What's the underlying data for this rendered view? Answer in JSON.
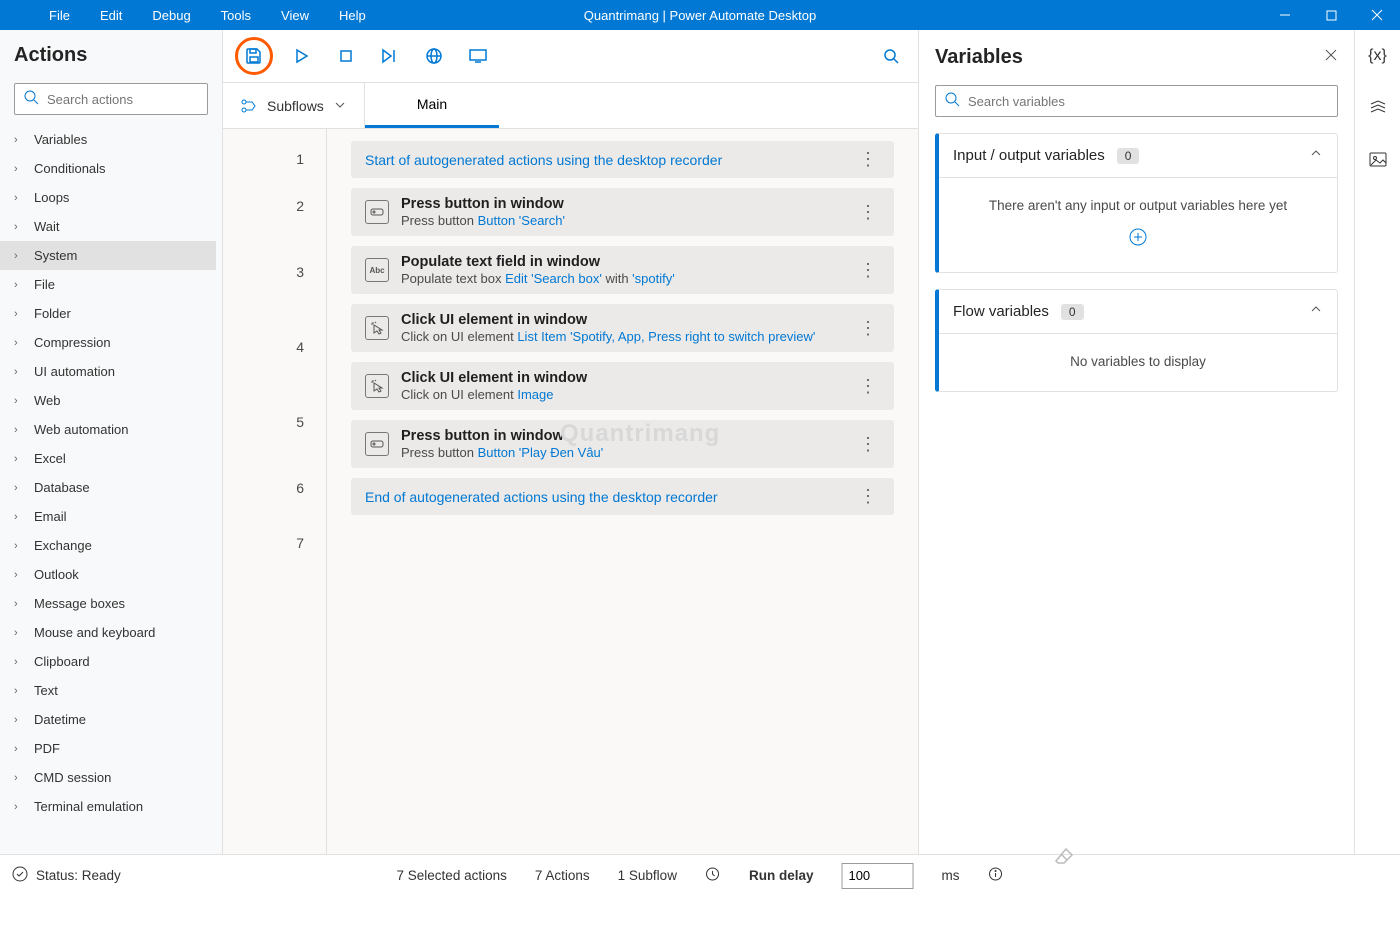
{
  "titlebar": {
    "menus": [
      "File",
      "Edit",
      "Debug",
      "Tools",
      "View",
      "Help"
    ],
    "title": "Quantrimang | Power Automate Desktop"
  },
  "actions": {
    "header": "Actions",
    "search_placeholder": "Search actions",
    "categories": [
      {
        "label": "Variables",
        "selected": false
      },
      {
        "label": "Conditionals",
        "selected": false
      },
      {
        "label": "Loops",
        "selected": false
      },
      {
        "label": "Wait",
        "selected": false
      },
      {
        "label": "System",
        "selected": true
      },
      {
        "label": "File",
        "selected": false
      },
      {
        "label": "Folder",
        "selected": false
      },
      {
        "label": "Compression",
        "selected": false
      },
      {
        "label": "UI automation",
        "selected": false
      },
      {
        "label": "Web",
        "selected": false
      },
      {
        "label": "Web automation",
        "selected": false
      },
      {
        "label": "Excel",
        "selected": false
      },
      {
        "label": "Database",
        "selected": false
      },
      {
        "label": "Email",
        "selected": false
      },
      {
        "label": "Exchange",
        "selected": false
      },
      {
        "label": "Outlook",
        "selected": false
      },
      {
        "label": "Message boxes",
        "selected": false
      },
      {
        "label": "Mouse and keyboard",
        "selected": false
      },
      {
        "label": "Clipboard",
        "selected": false
      },
      {
        "label": "Text",
        "selected": false
      },
      {
        "label": "Datetime",
        "selected": false
      },
      {
        "label": "PDF",
        "selected": false
      },
      {
        "label": "CMD session",
        "selected": false
      },
      {
        "label": "Terminal emulation",
        "selected": false
      }
    ]
  },
  "workspace": {
    "subflows_label": "Subflows",
    "tabs": [
      {
        "label": "Main",
        "active": true
      }
    ],
    "steps": [
      {
        "n": "1",
        "kind": "marker",
        "text": "Start of autogenerated actions using the desktop recorder"
      },
      {
        "n": "2",
        "kind": "action",
        "icon": "button",
        "title": "Press button in window",
        "sub_pre": "Press button ",
        "sub_link": "Button 'Search'",
        "sub_post": ""
      },
      {
        "n": "3",
        "kind": "action",
        "icon": "abc",
        "title": "Populate text field in window",
        "sub_pre": "Populate text box ",
        "sub_link": "Edit 'Search box'",
        "sub_mid": " with ",
        "sub_link2": "'spotify'"
      },
      {
        "n": "4",
        "kind": "action",
        "icon": "click",
        "title": "Click UI element in window",
        "sub_pre": "Click on UI element ",
        "sub_link": "List Item 'Spotify, App, Press right to switch preview'",
        "tall": true
      },
      {
        "n": "5",
        "kind": "action",
        "icon": "click",
        "title": "Click UI element in window",
        "sub_pre": "Click on UI element ",
        "sub_link": "Image"
      },
      {
        "n": "6",
        "kind": "action",
        "icon": "button",
        "title": "Press button in window",
        "sub_pre": "Press button ",
        "sub_link": "Button 'Play Đen Vâu'"
      },
      {
        "n": "7",
        "kind": "marker",
        "text": "End of autogenerated actions using the desktop recorder"
      }
    ],
    "watermark": "Quantrimang"
  },
  "variables": {
    "header": "Variables",
    "search_placeholder": "Search variables",
    "io": {
      "title": "Input / output variables",
      "count": "0",
      "empty": "There aren't any input or output variables here yet"
    },
    "flow": {
      "title": "Flow variables",
      "count": "0",
      "empty": "No variables to display"
    }
  },
  "statusbar": {
    "status": "Status: Ready",
    "sel": "7 Selected actions",
    "act": "7 Actions",
    "sub": "1 Subflow",
    "rd_label": "Run delay",
    "rd_value": "100",
    "rd_unit": "ms"
  }
}
